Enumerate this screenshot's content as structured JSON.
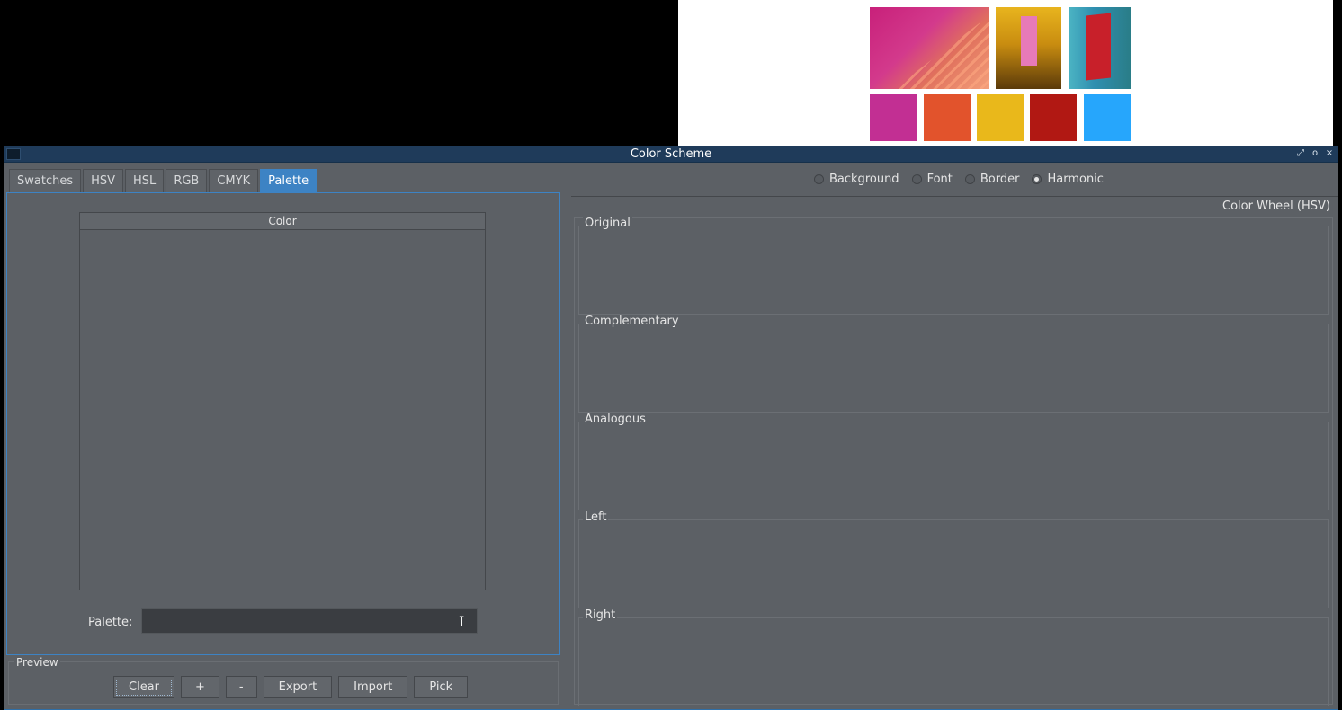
{
  "window": {
    "title": "Color Scheme"
  },
  "colors": {
    "swatch1": "#c22f93",
    "swatch2": "#e2532c",
    "swatch3": "#e9b81b",
    "swatch4": "#b11813",
    "swatch5": "#26a6fc",
    "accent": "#3d83c4"
  },
  "tabs": [
    {
      "label": "Swatches"
    },
    {
      "label": "HSV"
    },
    {
      "label": "HSL"
    },
    {
      "label": "RGB"
    },
    {
      "label": "CMYK"
    },
    {
      "label": "Palette"
    }
  ],
  "palette_panel": {
    "table_header": "Color",
    "palette_label": "Palette:",
    "palette_value": ""
  },
  "preview": {
    "label": "Preview",
    "buttons": {
      "clear": "Clear",
      "add": "+",
      "remove": "-",
      "export": "Export",
      "import": "Import",
      "pick": "Pick"
    }
  },
  "target_options": [
    {
      "label": "Background",
      "selected": false
    },
    {
      "label": "Font",
      "selected": false
    },
    {
      "label": "Border",
      "selected": false
    },
    {
      "label": "Harmonic",
      "selected": true
    }
  ],
  "wheel": {
    "label": "Color Wheel (HSV)",
    "schemes": [
      "Original",
      "Complementary",
      "Analogous",
      "Left",
      "Right"
    ]
  }
}
